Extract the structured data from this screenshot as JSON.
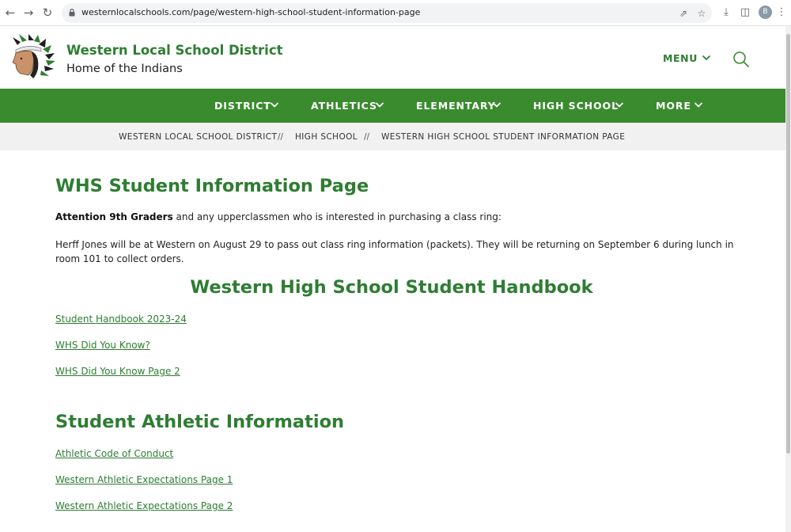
{
  "browser": {
    "url": "westernlocalschools.com/page/western-high-school-student-information-page",
    "profile_initial": "B"
  },
  "site": {
    "title": "Western Local School District",
    "subtitle": "Home of the Indians",
    "menu_label": "MENU",
    "accent_color": "#3a8b2e"
  },
  "nav": {
    "items": [
      {
        "label": "DISTRICT"
      },
      {
        "label": "ATHLETICS"
      },
      {
        "label": "ELEMENTARY"
      },
      {
        "label": "HIGH SCHOOL"
      },
      {
        "label": "MORE"
      }
    ]
  },
  "breadcrumb": {
    "items": [
      "WESTERN LOCAL SCHOOL DISTRICT",
      "HIGH SCHOOL",
      "WESTERN HIGH SCHOOL STUDENT INFORMATION PAGE"
    ],
    "separator": "//"
  },
  "content": {
    "page_title": "WHS Student Information Page",
    "attention_bold": "Attention 9th Graders",
    "attention_rest": " and any upperclassmen who is interested in purchasing a class ring:",
    "ring_info": "Herff Jones will be at Western on August 29 to pass out class ring information (packets). They will be returning on September 6 during lunch in room 101 to collect orders.",
    "handbook_heading": "Western High School Student Handbook",
    "handbook_links": [
      "Student Handbook 2023-24",
      "WHS Did You Know?",
      "WHS Did You Know Page 2"
    ],
    "athletic_heading": "Student Athletic Information",
    "athletic_links": [
      "Athletic Code of Conduct",
      "Western Athletic Expectations Page 1",
      "Western Athletic Expectations Page 2"
    ]
  }
}
